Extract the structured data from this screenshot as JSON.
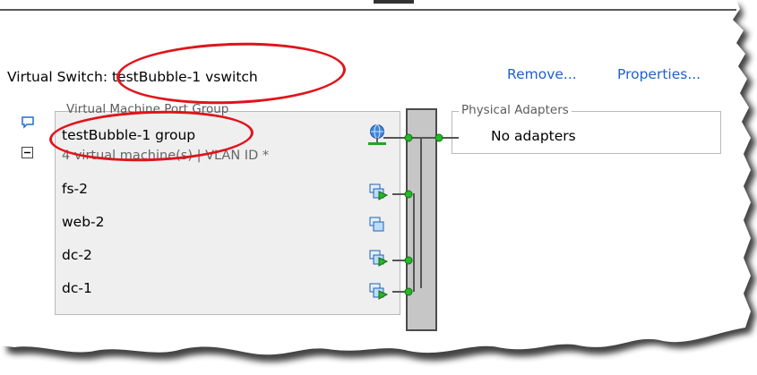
{
  "vswitch": {
    "title": "Virtual Switch: testBubble-1 vswitch",
    "remove_label": "Remove...",
    "properties_label": "Properties..."
  },
  "port_group": {
    "legend": "Virtual Machine Port Group",
    "name": "testBubble-1 group",
    "summary": "4 virtual machine(s) | VLAN ID *",
    "vms": [
      {
        "name": "fs-2",
        "icon": "vm-powered-on-icon"
      },
      {
        "name": "web-2",
        "icon": "vm-powered-off-icon"
      },
      {
        "name": "dc-2",
        "icon": "vm-powered-on-icon"
      },
      {
        "name": "dc-1",
        "icon": "vm-powered-on-icon"
      }
    ]
  },
  "physical_adapters": {
    "legend": "Physical Adapters",
    "status": "No adapters"
  },
  "colors": {
    "highlight_ellipse": "#e0141b",
    "link": "#1f5fd1",
    "connector_green": "#22bb22"
  }
}
